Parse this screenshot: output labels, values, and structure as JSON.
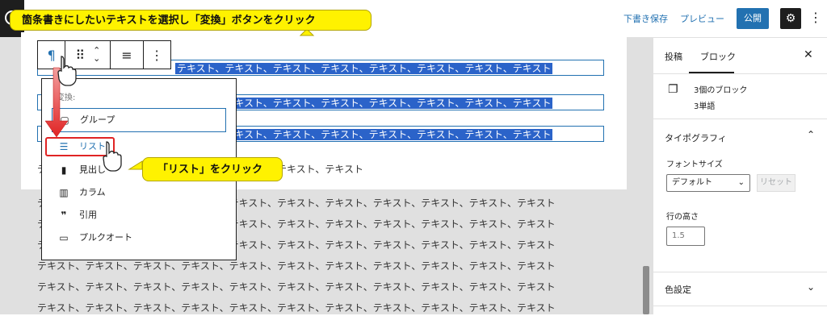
{
  "topbar": {
    "draft_label": "下書き保存",
    "preview_label": "プレビュー",
    "publish_label": "公開",
    "settings_icon": "gear-icon",
    "more_icon": "more-vertical-icon"
  },
  "toolbar": {
    "paragraph_icon": "¶",
    "drag_icon": "⠿",
    "align_icon": "≡",
    "more_icon": "⋮"
  },
  "editor": {
    "selected_text": "テキスト、テキスト、テキスト、テキスト、テキスト、テキスト、テキスト、テキスト",
    "partial_text": "テキスト、テキスト、テキスト、テキスト、テキスト、テキスト、テキスト",
    "body_text": "テキスト、テキスト、テキスト、テキスト、テキスト、テキスト、テキスト、テキスト、テキスト、テキスト、テキスト"
  },
  "transform_menu": {
    "heading": "変換:",
    "items": [
      {
        "label": "グループ",
        "icon": "group-icon"
      },
      {
        "label": "リスト",
        "icon": "list-icon"
      },
      {
        "label": "見出し",
        "icon": "heading-icon"
      },
      {
        "label": "カラム",
        "icon": "columns-icon"
      },
      {
        "label": "引用",
        "icon": "quote-icon"
      },
      {
        "label": "プルクオート",
        "icon": "pullquote-icon"
      }
    ]
  },
  "sidebar": {
    "tabs": [
      "投稿",
      "ブロック"
    ],
    "close_icon": "close-icon",
    "block_count": "3個のブロック",
    "word_count": "3単語",
    "typography_title": "タイポグラフィ",
    "font_size_label": "フォントサイズ",
    "font_size_value": "デフォルト",
    "reset_label": "リセット",
    "line_height_label": "行の高さ",
    "line_height_value": "1.5",
    "color_title": "色設定"
  },
  "callouts": {
    "top": "箇条書きにしたいテキストを選択し「変換」ボタンをクリック",
    "list": "「リスト」をクリック"
  },
  "colors": {
    "accent": "#2271b1",
    "highlight": "#fff200",
    "arrow": "#e02424",
    "selection": "#2b63c9"
  }
}
